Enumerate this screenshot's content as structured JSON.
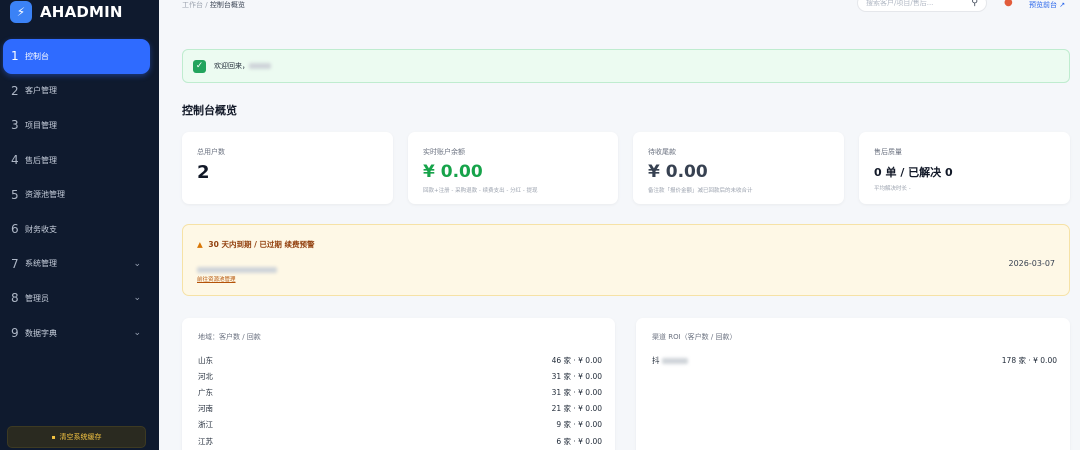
{
  "brand": {
    "name": "AHADMIN",
    "logo_icon": "bolt-icon"
  },
  "sidebar": {
    "items": [
      {
        "num": "1",
        "label": "控制台",
        "active": true,
        "has_chevron": false
      },
      {
        "num": "2",
        "label": "客户管理",
        "active": false,
        "has_chevron": false
      },
      {
        "num": "3",
        "label": "项目管理",
        "active": false,
        "has_chevron": false
      },
      {
        "num": "4",
        "label": "售后管理",
        "active": false,
        "has_chevron": false
      },
      {
        "num": "5",
        "label": "资源池管理",
        "active": false,
        "has_chevron": false
      },
      {
        "num": "6",
        "label": "财务收支",
        "active": false,
        "has_chevron": false
      },
      {
        "num": "7",
        "label": "系统管理",
        "active": false,
        "has_chevron": true
      },
      {
        "num": "8",
        "label": "管理员",
        "active": false,
        "has_chevron": true
      },
      {
        "num": "9",
        "label": "数据字典",
        "active": false,
        "has_chevron": true
      }
    ],
    "clear_cache_label": "清空系统缓存"
  },
  "topbar": {
    "breadcrumb_root": "工作台 /",
    "breadcrumb_current": "控制台概览",
    "search_placeholder": "搜索客户/项目/售后...",
    "preview_label": "预览前台"
  },
  "welcome": {
    "text": "欢迎回来，"
  },
  "overview": {
    "title": "控制台概览",
    "cards": [
      {
        "label": "总用户数",
        "value": "2",
        "sub": ""
      },
      {
        "label": "实时账户余额",
        "value": "¥ 0.00",
        "sub": "回款+注册 - 采购退款 - 续费支出 - 分红 - 提现"
      },
      {
        "label": "待收尾款",
        "value": "¥ 0.00",
        "sub": "备注款「报价金额」减已回款后的未收合计"
      },
      {
        "label": "售后质量",
        "value": "0 单 / 已解决 0",
        "sub": "平均解决时长 -"
      }
    ]
  },
  "warning": {
    "title": "30 天内到期 / 已过期 续费预警",
    "date": "2026-03-07",
    "link": "前往资源池管理"
  },
  "region_panel": {
    "title": "地域：客户数 / 回款",
    "rows": [
      {
        "name": "山东",
        "value": "46 家 · ¥ 0.00"
      },
      {
        "name": "河北",
        "value": "31 家 · ¥ 0.00"
      },
      {
        "name": "广东",
        "value": "31 家 · ¥ 0.00"
      },
      {
        "name": "河南",
        "value": "21 家 · ¥ 0.00"
      },
      {
        "name": "浙江",
        "value": "9 家 · ¥ 0.00"
      },
      {
        "name": "江苏",
        "value": "6 家 · ¥ 0.00"
      }
    ]
  },
  "channel_panel": {
    "title": "渠道 ROI（客户数 / 回款）",
    "rows": [
      {
        "name": "抖",
        "value": "178 家 · ¥ 0.00"
      }
    ]
  },
  "colors": {
    "sidebar_bg": "#0f1a2e",
    "accent": "#2f6bff",
    "success": "#16a34a",
    "warning_bg": "#fef8e6"
  }
}
